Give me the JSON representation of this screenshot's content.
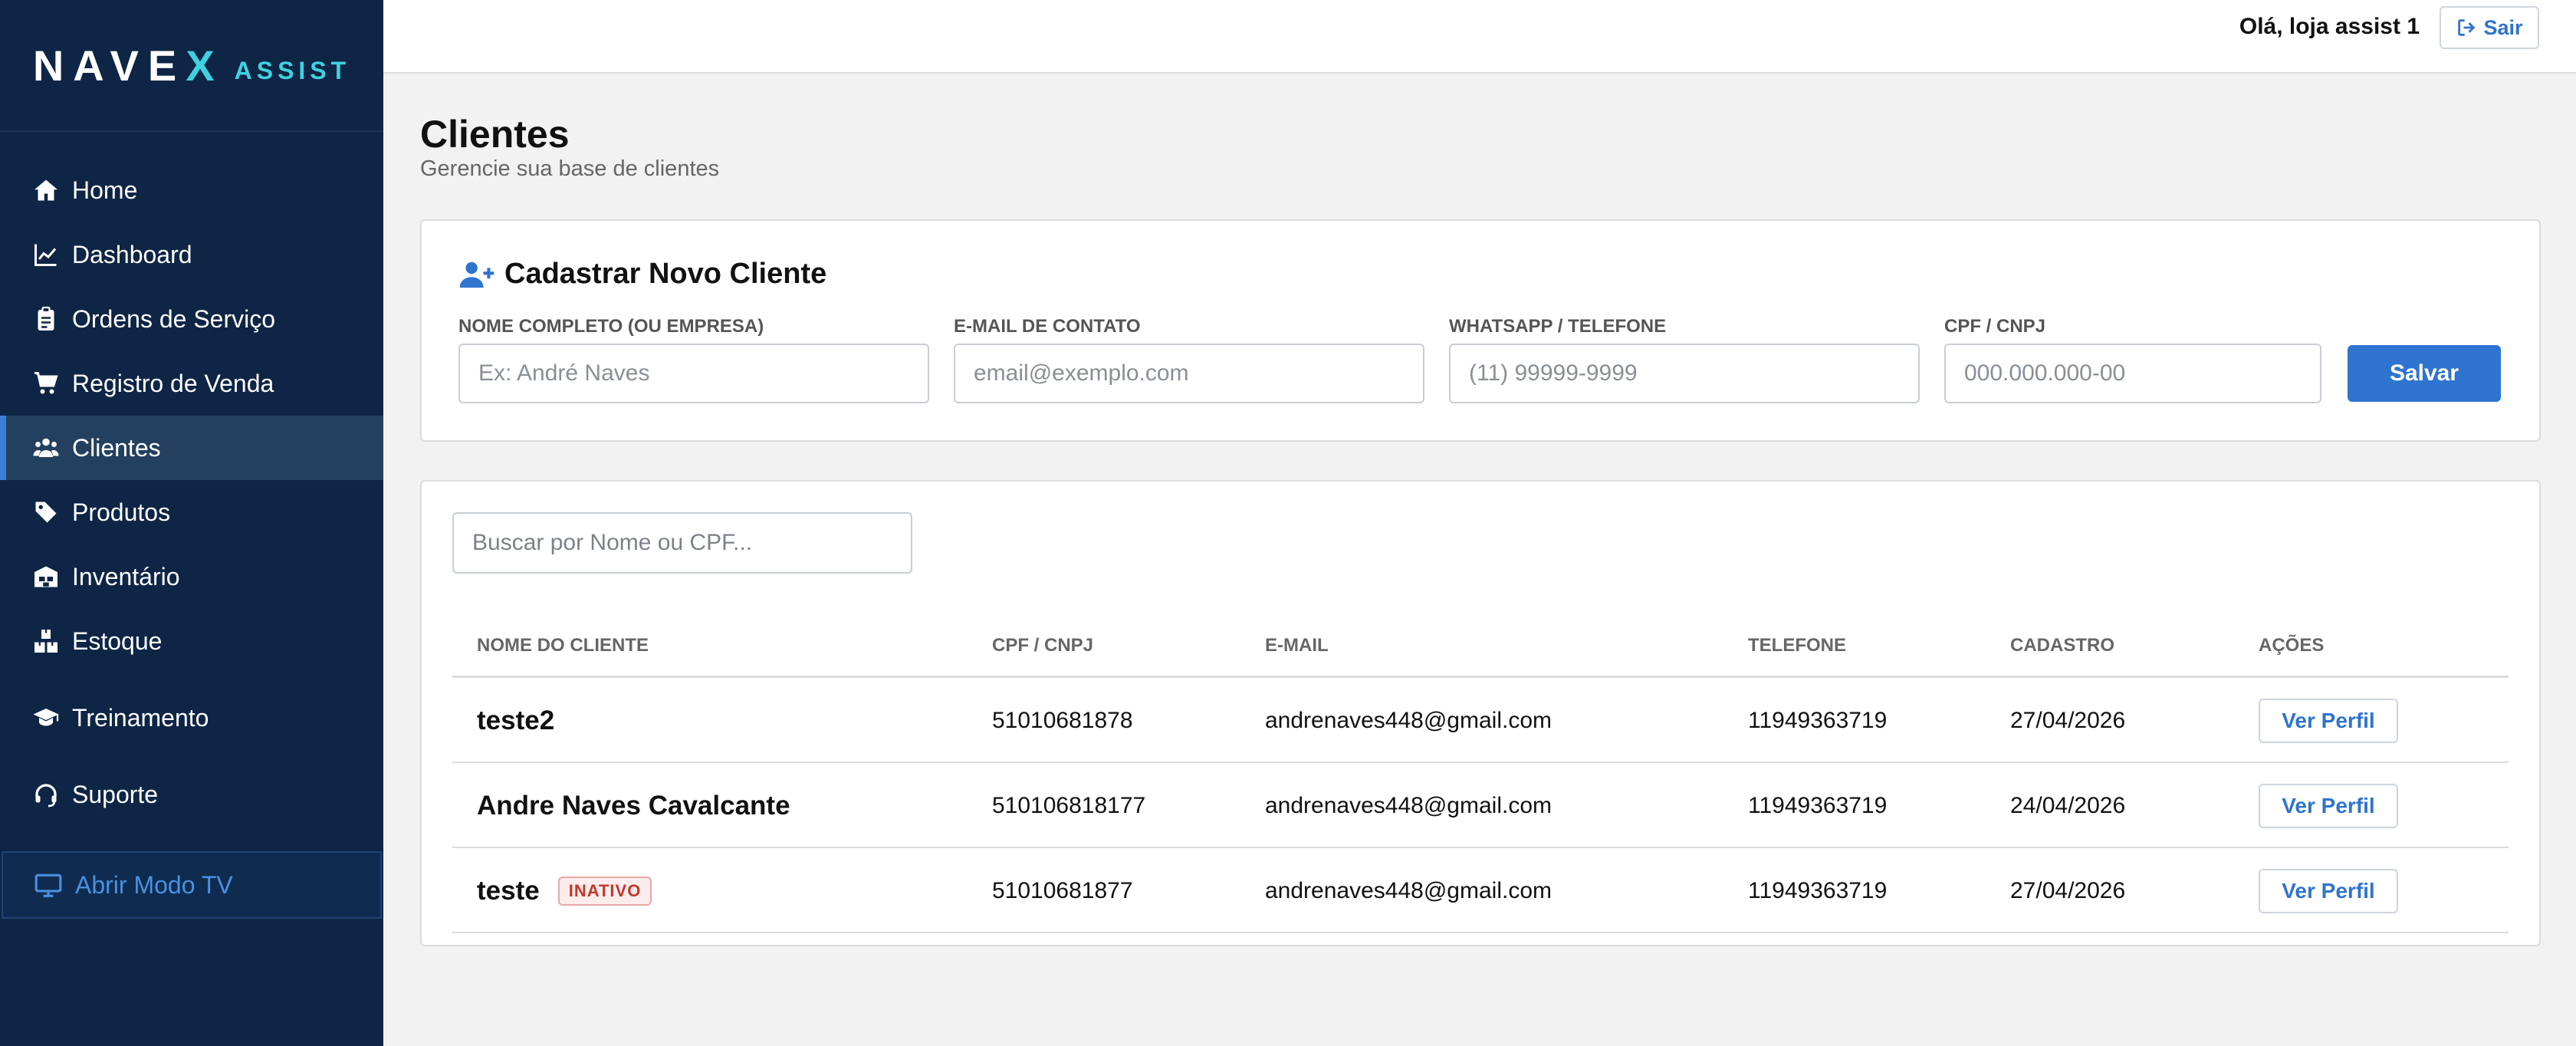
{
  "brand": {
    "logo_pre": "NAVE",
    "logo_x": "X",
    "logo_sub": "ASSIST"
  },
  "sidebar": {
    "items": [
      {
        "label": "Home",
        "icon": "home-icon"
      },
      {
        "label": "Dashboard",
        "icon": "chart-line-icon"
      },
      {
        "label": "Ordens de Serviço",
        "icon": "clipboard-icon"
      },
      {
        "label": "Registro de Venda",
        "icon": "cart-icon"
      },
      {
        "label": "Clientes",
        "icon": "users-icon"
      },
      {
        "label": "Produtos",
        "icon": "tag-icon"
      },
      {
        "label": "Inventário",
        "icon": "warehouse-icon"
      },
      {
        "label": "Estoque",
        "icon": "boxes-icon"
      },
      {
        "label": "Treinamento",
        "icon": "graduation-cap-icon"
      },
      {
        "label": "Suporte",
        "icon": "headset-icon"
      }
    ],
    "active": "Clientes",
    "tv_button": "Abrir Modo TV"
  },
  "header": {
    "greeting": "Olá, loja assist 1",
    "logout_label": "Sair"
  },
  "page": {
    "title": "Clientes",
    "subtitle": "Gerencie sua base de clientes"
  },
  "form": {
    "title": "Cadastrar Novo Cliente",
    "fields": [
      {
        "label": "NOME COMPLETO (OU EMPRESA)",
        "placeholder": "Ex: André Naves",
        "value": ""
      },
      {
        "label": "E-MAIL DE CONTATO",
        "placeholder": "email@exemplo.com",
        "value": ""
      },
      {
        "label": "WHATSAPP / TELEFONE",
        "placeholder": "(11) 99999-9999",
        "value": ""
      },
      {
        "label": "CPF / CNPJ",
        "placeholder": "000.000.000-00",
        "value": ""
      }
    ],
    "save_label": "Salvar"
  },
  "search": {
    "placeholder": "Buscar por Nome ou CPF...",
    "value": ""
  },
  "table": {
    "headers": [
      "NOME DO CLIENTE",
      "CPF / CNPJ",
      "E-MAIL",
      "TELEFONE",
      "CADASTRO",
      "AÇÕES"
    ],
    "rows": [
      {
        "name": "teste2",
        "badge": "",
        "doc": "51010681878",
        "email": "andrenaves448@gmail.com",
        "phone": "11949363719",
        "date": "27/04/2026",
        "action": "Ver Perfil"
      },
      {
        "name": "Andre Naves Cavalcante",
        "badge": "",
        "doc": "510106818177",
        "email": "andrenaves448@gmail.com",
        "phone": "11949363719",
        "date": "24/04/2026",
        "action": "Ver Perfil"
      },
      {
        "name": "teste",
        "badge": "INATIVO",
        "doc": "51010681877",
        "email": "andrenaves448@gmail.com",
        "phone": "11949363719",
        "date": "27/04/2026",
        "action": "Ver Perfil"
      }
    ]
  },
  "colors": {
    "sidebar_bg": "#0e2545",
    "accent": "#2f74cf",
    "brand_cyan": "#3fd1e0",
    "inactive_badge": "#c0392b"
  }
}
